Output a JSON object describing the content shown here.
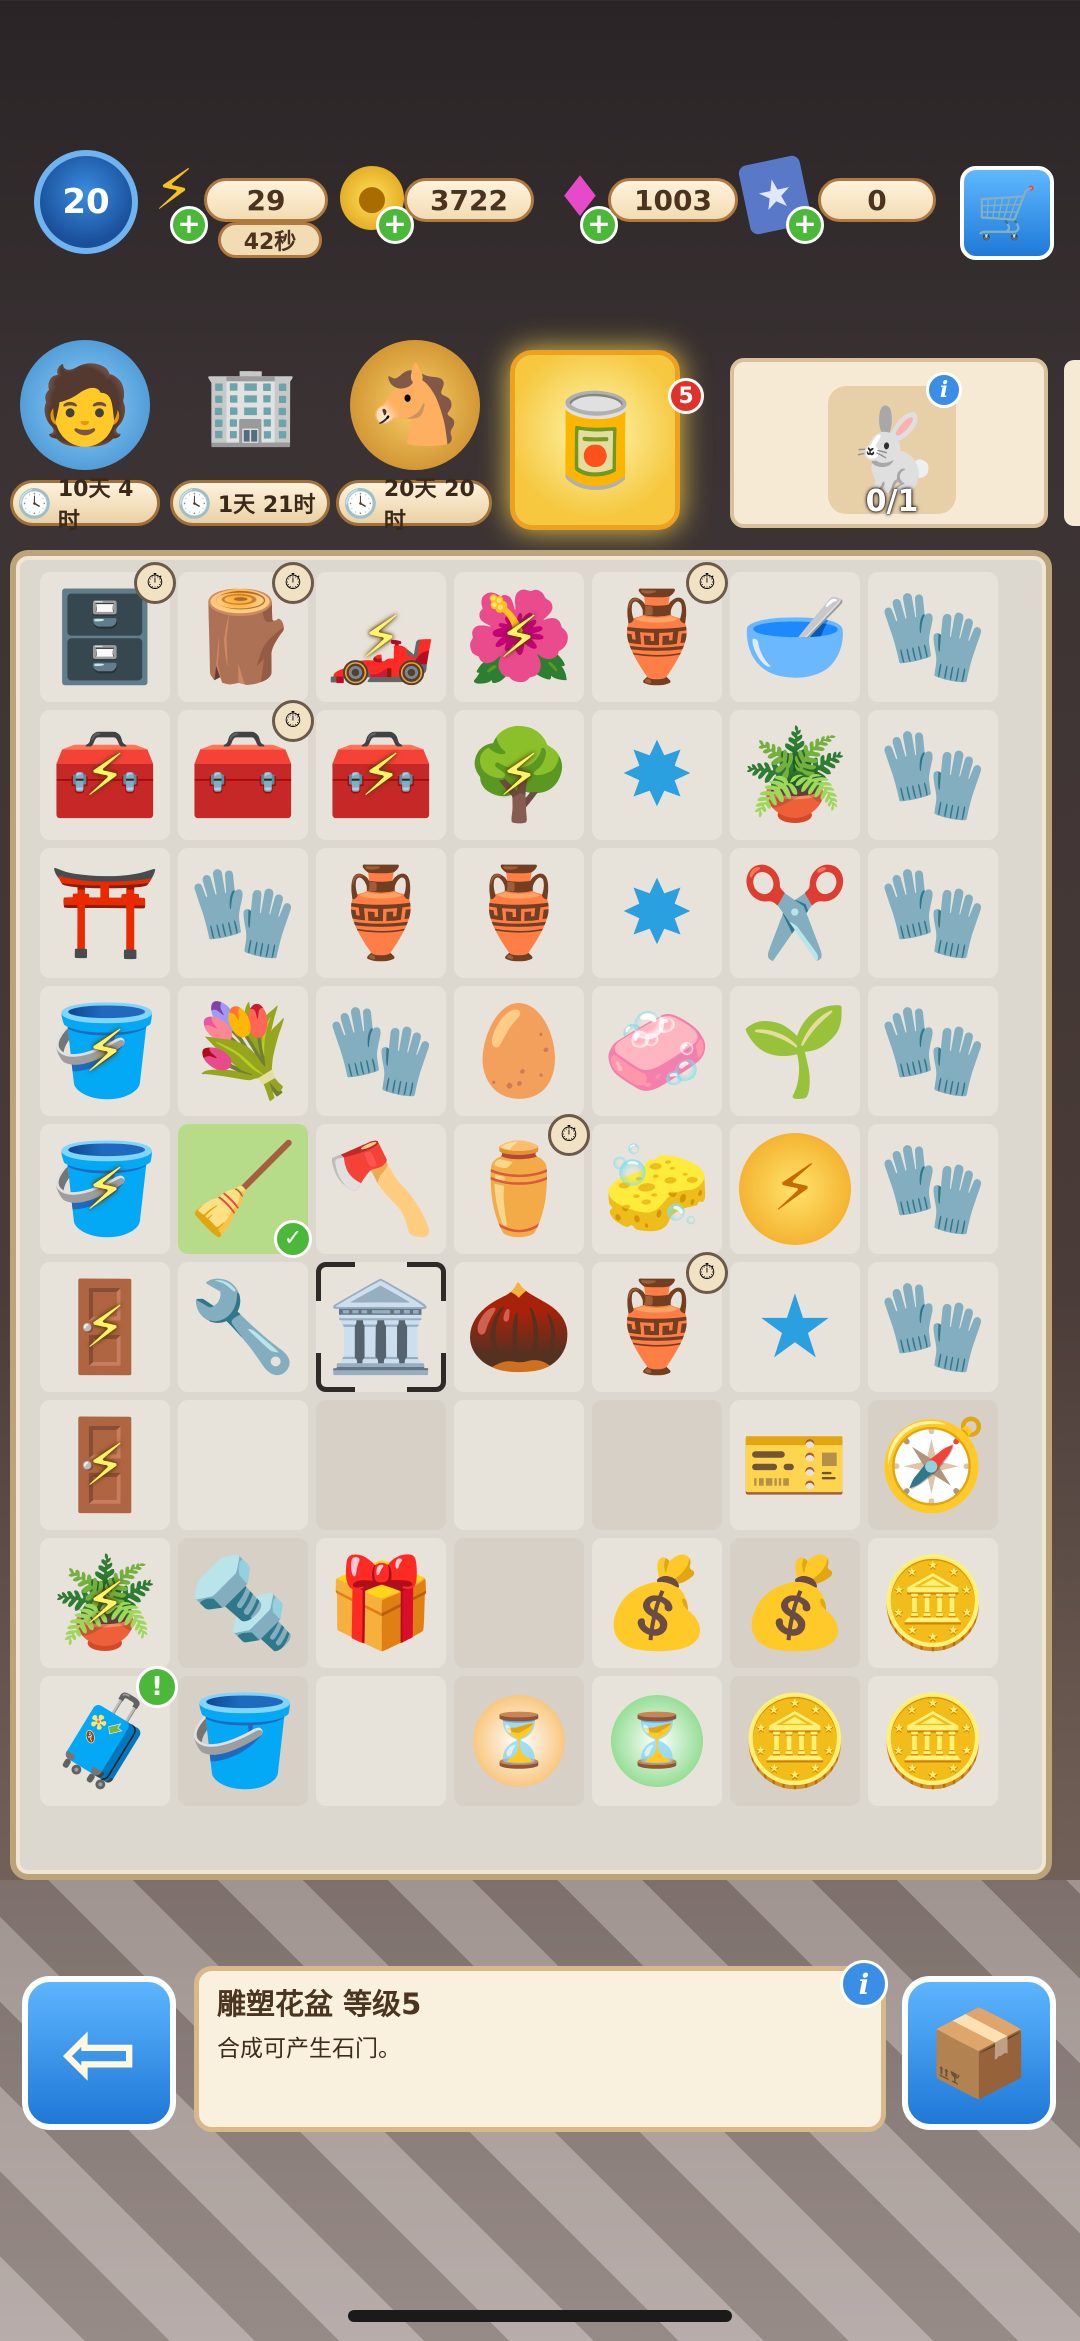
{
  "top_bar": {
    "level": "20",
    "energy": "29",
    "energy_timer": "42秒",
    "coins": "3722",
    "gems": "1003",
    "cards": "0"
  },
  "events": [
    {
      "name": "character",
      "timer": "10天 4时"
    },
    {
      "name": "buildings",
      "timer": "1天 21时"
    },
    {
      "name": "horse",
      "timer": "20天 20时"
    }
  ],
  "feature_badge": "5",
  "order": {
    "progress": "0/1"
  },
  "item_info": {
    "title": "雕塑花盆 等级5",
    "description": "合成可产生石门。"
  },
  "colors": {
    "accent_blue": "#1f78d6",
    "panel_cream": "#faf0de",
    "board_frame": "#bca478",
    "plus_green": "#4cb83a"
  }
}
